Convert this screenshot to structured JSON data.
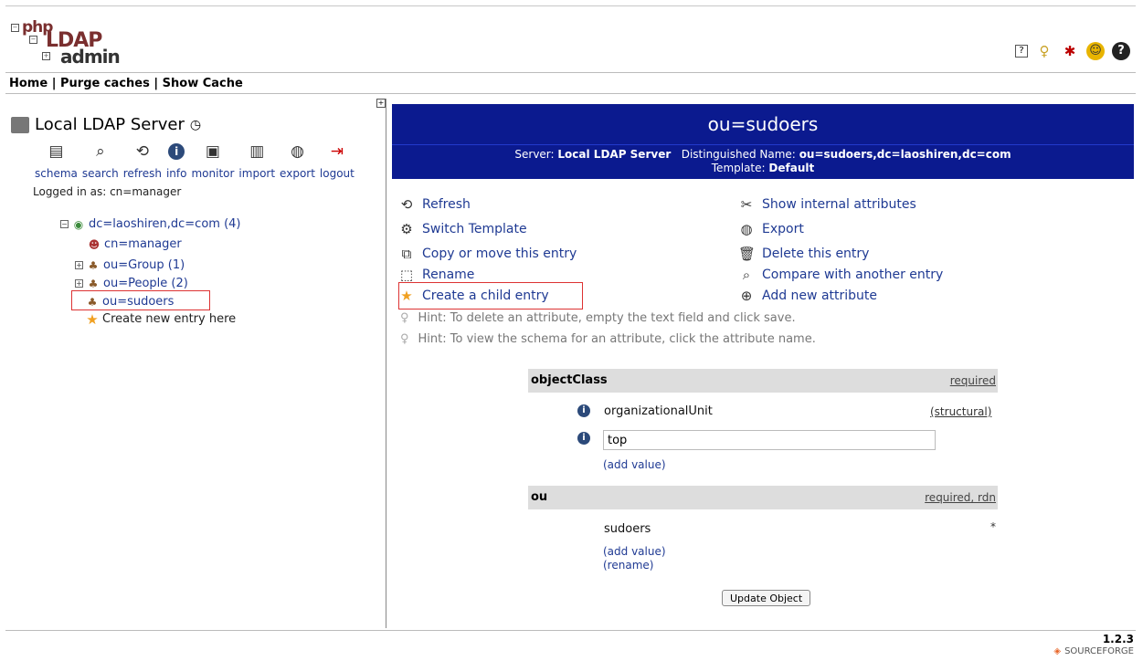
{
  "logo": {
    "php": "php",
    "ldap": "LDAP",
    "admin": "admin"
  },
  "menu": {
    "home": "Home",
    "purge": "Purge caches",
    "show_cache": "Show Cache",
    "sep": "|"
  },
  "server": {
    "name": "Local LDAP Server"
  },
  "tools": [
    {
      "label": "schema",
      "icon": "schema-icon"
    },
    {
      "label": "search",
      "icon": "search-icon"
    },
    {
      "label": "refresh",
      "icon": "refresh-icon"
    },
    {
      "label": "info",
      "icon": "info-icon"
    },
    {
      "label": "monitor",
      "icon": "monitor-icon"
    },
    {
      "label": "import",
      "icon": "import-icon"
    },
    {
      "label": "export",
      "icon": "export-icon"
    },
    {
      "label": "logout",
      "icon": "logout-icon"
    }
  ],
  "logged_in": "Logged in as: cn=manager",
  "tree": {
    "root": "dc=laoshiren,dc=com (4)",
    "items": [
      "cn=manager",
      "ou=Group (1)",
      "ou=People (2)",
      "ou=sudoers",
      "Create new entry here"
    ]
  },
  "entry": {
    "title": "ou=sudoers",
    "server_label": "Server:",
    "server_value": "Local LDAP Server",
    "dn_label": "Distinguished Name:",
    "dn_value": "ou=sudoers,dc=laoshiren,dc=com",
    "template_label": "Template:",
    "template_value": "Default"
  },
  "actions_left": [
    "Refresh",
    "Switch Template",
    "Copy or move this entry",
    "Rename",
    "Create a child entry"
  ],
  "actions_right": [
    "Show internal attributes",
    "Export",
    "Delete this entry",
    "Compare with another entry",
    "Add new attribute"
  ],
  "hints": [
    "Hint: To delete an attribute, empty the text field and click save.",
    "Hint: To view the schema for an attribute, click the attribute name."
  ],
  "attrs": {
    "objectclass": {
      "name": "objectClass",
      "req": "required",
      "value1": "organizationalUnit",
      "value1_note": "(structural)",
      "value2": "top",
      "add_value": "(add value)"
    },
    "ou": {
      "name": "ou",
      "req": "required, rdn",
      "value": "sudoers",
      "star": "*",
      "add_value": "(add value)",
      "rename": "(rename)"
    }
  },
  "update_button": "Update Object",
  "footer": {
    "version": "1.2.3",
    "sourceforge": "SOURCEFORGE"
  },
  "colors": {
    "title_bg": "#0b1a8f",
    "link": "#1f3a93",
    "highlight": "#dd3333"
  }
}
